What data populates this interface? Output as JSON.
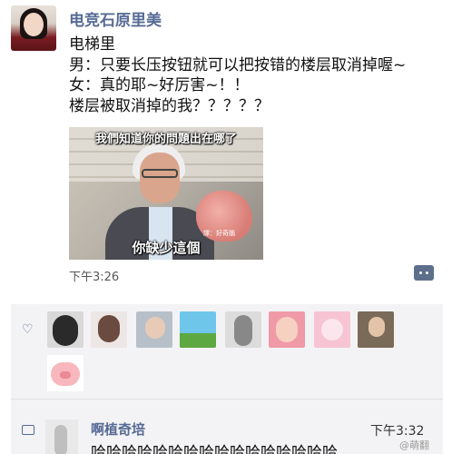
{
  "post": {
    "username": "电竞石原里美",
    "lines": [
      "电梯里",
      "男：只要长压按钮就可以把按错的楼层取消掉喔~",
      "女：真的耶~好厉害~！！",
      "楼层被取消掉的我？？？？？"
    ],
    "image": {
      "caption_top": "我們知道你的問題出在哪了",
      "caption_bottom": "你缺少這個",
      "caption_mini": "譯：好奇腦"
    },
    "timestamp": "下午3:26"
  },
  "likes": {
    "avatars": [
      {
        "name": "like-avatar-1",
        "color": "#d9d9d9"
      },
      {
        "name": "like-avatar-2",
        "color": "#ece6e4"
      },
      {
        "name": "like-avatar-3",
        "color": "#b7c0c8"
      },
      {
        "name": "like-avatar-4",
        "color": "#6ec6ea"
      },
      {
        "name": "like-avatar-5",
        "color": "#dcdcdc"
      },
      {
        "name": "like-avatar-6",
        "color": "#f09aa8"
      },
      {
        "name": "like-avatar-7",
        "color": "#f6c4d2"
      },
      {
        "name": "like-avatar-8",
        "color": "#7a6a58"
      },
      {
        "name": "like-avatar-9",
        "color": "#f7b7bd"
      }
    ]
  },
  "comment": {
    "name": "啊植奇培",
    "time": "下午3:32",
    "text": "哈哈哈哈哈哈哈哈哈哈哈哈哈哈哈哈"
  },
  "watermark": "@萌翻",
  "colors": {
    "link": "#576b95",
    "panel": "#f3f3f5"
  }
}
